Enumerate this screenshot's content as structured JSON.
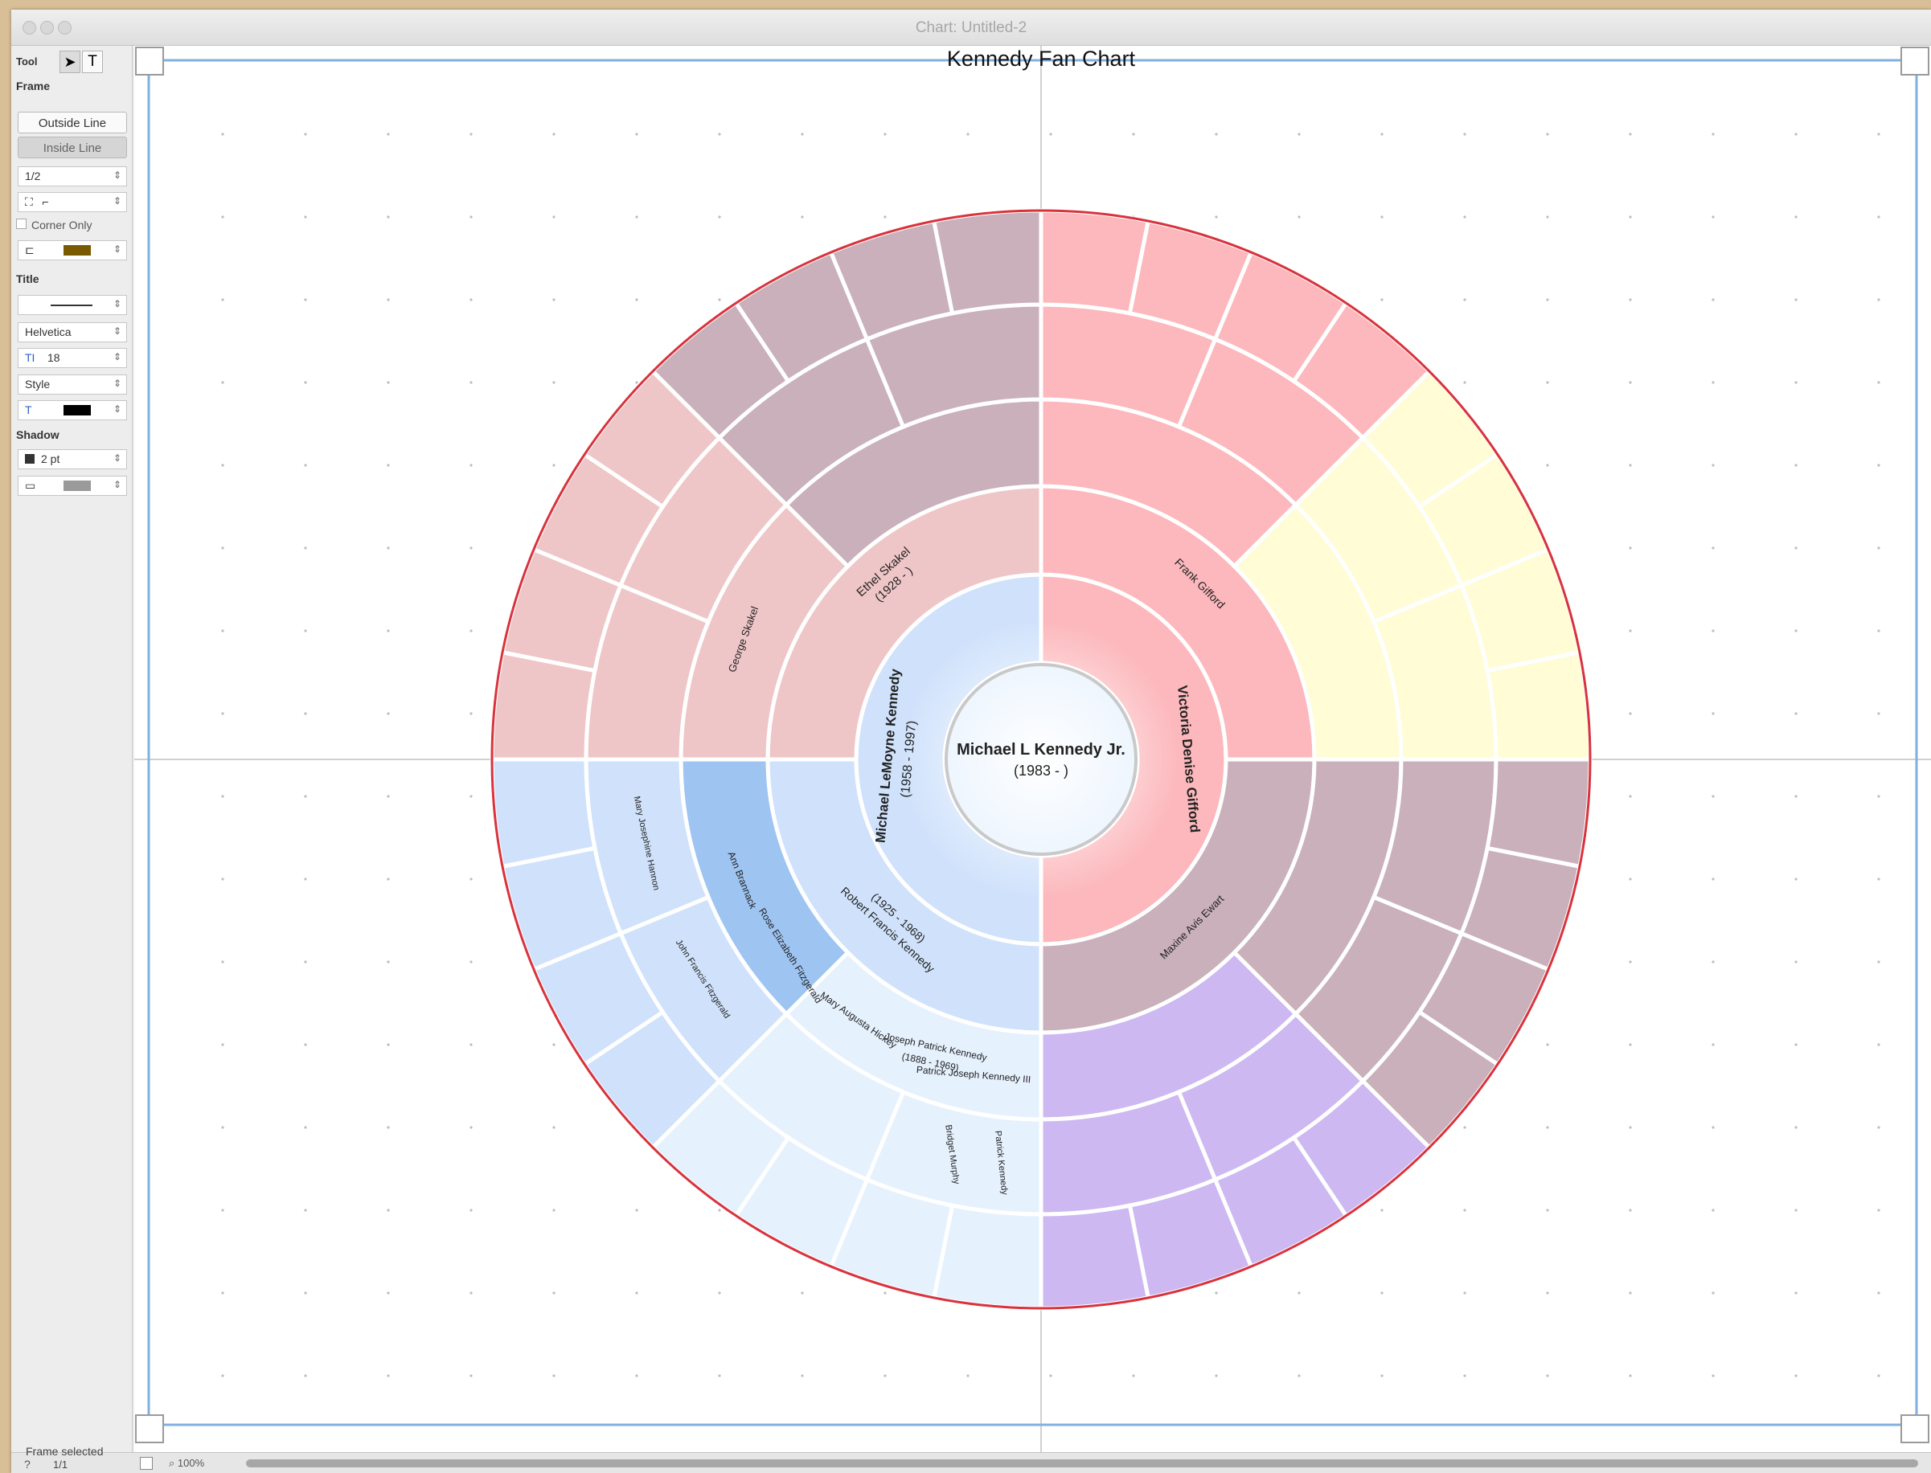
{
  "window": {
    "title": "Chart: Untitled-2"
  },
  "palette": {
    "tool_label": "Tool",
    "frame_heading": "Frame",
    "outside_line": "Outside Line",
    "inside_line": "Inside Line",
    "line_width": "1/2",
    "corner_only": "Corner Only",
    "frame_color": "#7a5a00",
    "title_heading": "Title",
    "font": "Helvetica",
    "font_size": "18",
    "style": "Style",
    "text_color": "#000000",
    "shadow_heading": "Shadow",
    "shadow_size": "2 pt",
    "shadow_color": "#9a9a9a"
  },
  "chart": {
    "title": "Kennedy Fan Chart",
    "root_name": "Michael L Kennedy Jr.",
    "root_dates": "(1983 - )",
    "gen1": {
      "father_name": "Michael LeMoyne Kennedy",
      "father_dates": "(1958 - 1997)",
      "mother_name": "Victoria Denise Gifford"
    },
    "gen2": {
      "pgm_name": "Ethel Skakel",
      "pgm_dates": "(1928 - )",
      "pgf_name": "Robert Francis Kennedy",
      "pgf_dates": "(1925 - 1968)",
      "mgf_name": "Frank Gifford",
      "mgm_name": "Maxine Avis Ewart"
    },
    "gen3": {
      "george": "George Skakel",
      "ann": "Ann Brannack",
      "rose": "Rose Elizabeth Fitzgerald",
      "joseph": "Joseph Patrick Kennedy",
      "joseph_dates": "(1888 - 1969)",
      "mary": "Mary Augusta Hickey",
      "patrick": "Patrick Joseph Kennedy III"
    },
    "gen4": {
      "mary_josephine": "Mary Josephine Hannon",
      "john_francis": "John Francis Fitzgerald",
      "bridget": "Bridget Murphy",
      "patrick": "Patrick Kennedy"
    },
    "colors": {
      "root": "#e6f1fe",
      "paternal_father": "#d0e2fb",
      "paternal_mother": "#efc6c8",
      "maternal_father": "#fcb8bc",
      "maternal_mother": "#c9b0ba",
      "yellow": "#fffcd6",
      "purple": "#cdb8f2",
      "blue_mid": "#9ec4f2",
      "frame": "#d8333d"
    }
  },
  "status": {
    "text": "Frame selected",
    "page": "1/1",
    "help": "?",
    "zoom": "100%"
  }
}
